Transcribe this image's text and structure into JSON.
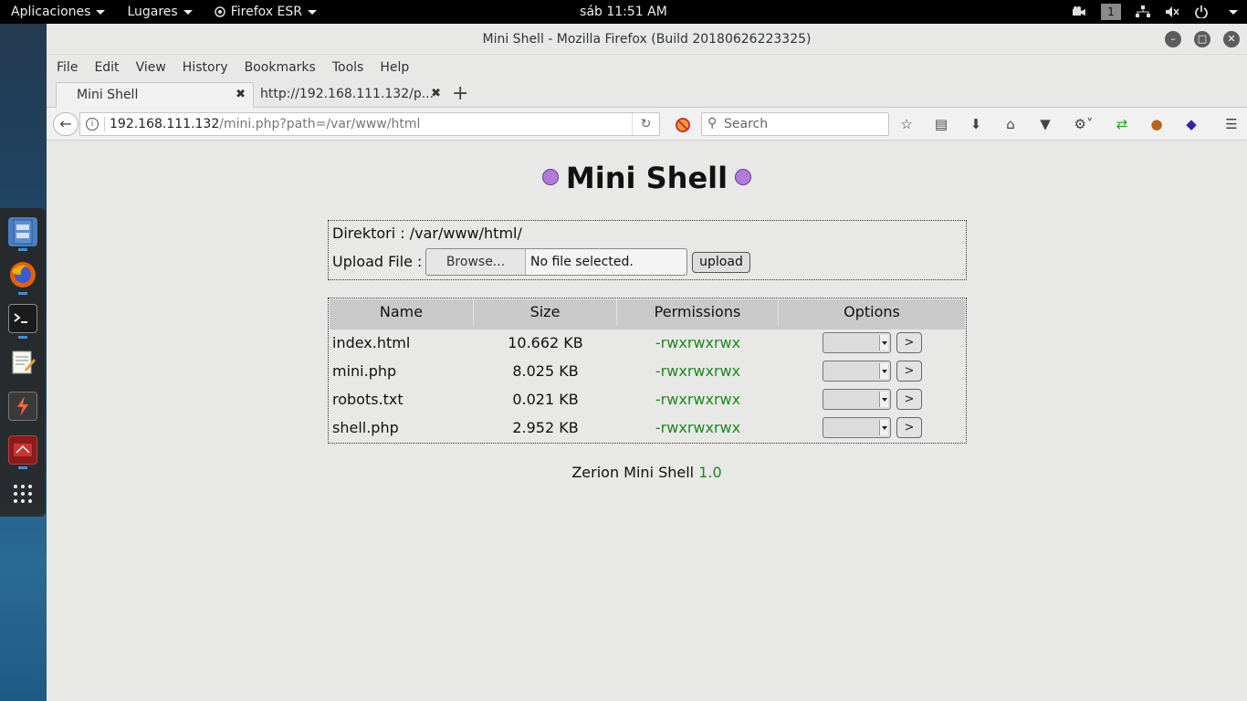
{
  "topbar": {
    "apps_menu": "Aplicaciones",
    "places_menu": "Lugares",
    "app_menu": "Firefox ESR",
    "clock": "sáb 11:51 AM",
    "workspace": "1"
  },
  "window": {
    "title": "Mini Shell - Mozilla Firefox (Build 20180626223325)"
  },
  "menubar": [
    "File",
    "Edit",
    "View",
    "History",
    "Bookmarks",
    "Tools",
    "Help"
  ],
  "tabs": [
    {
      "label": "Mini Shell",
      "active": true
    },
    {
      "label": "http://192.168.111.132/p...",
      "active": false
    }
  ],
  "navbar": {
    "url_host": "192.168.111.132",
    "url_path": "/mini.php?path=/var/www/html",
    "search_placeholder": "Search"
  },
  "page": {
    "heading": "Mini Shell",
    "directory_label": "Direktori : /var/www/html/",
    "upload_label": "Upload File :",
    "browse_label": "Browse...",
    "file_status": "No file selected.",
    "upload_button": "upload",
    "table": {
      "headers": [
        "Name",
        "Size",
        "Permissions",
        "Options"
      ],
      "rows": [
        {
          "name": "index.html",
          "size": "10.662 KB",
          "perm": "-rwxrwxrwx"
        },
        {
          "name": "mini.php",
          "size": "8.025 KB",
          "perm": "-rwxrwxrwx"
        },
        {
          "name": "robots.txt",
          "size": "0.021 KB",
          "perm": "-rwxrwxrwx"
        },
        {
          "name": "shell.php",
          "size": "2.952 KB",
          "perm": "-rwxrwxrwx"
        }
      ],
      "go_label": ">"
    },
    "footer_text": "Zerion Mini Shell ",
    "footer_version": "1.0"
  },
  "colors": {
    "permission_green": "#1a8a1a",
    "dock_indicator": "#3f8fd8"
  }
}
